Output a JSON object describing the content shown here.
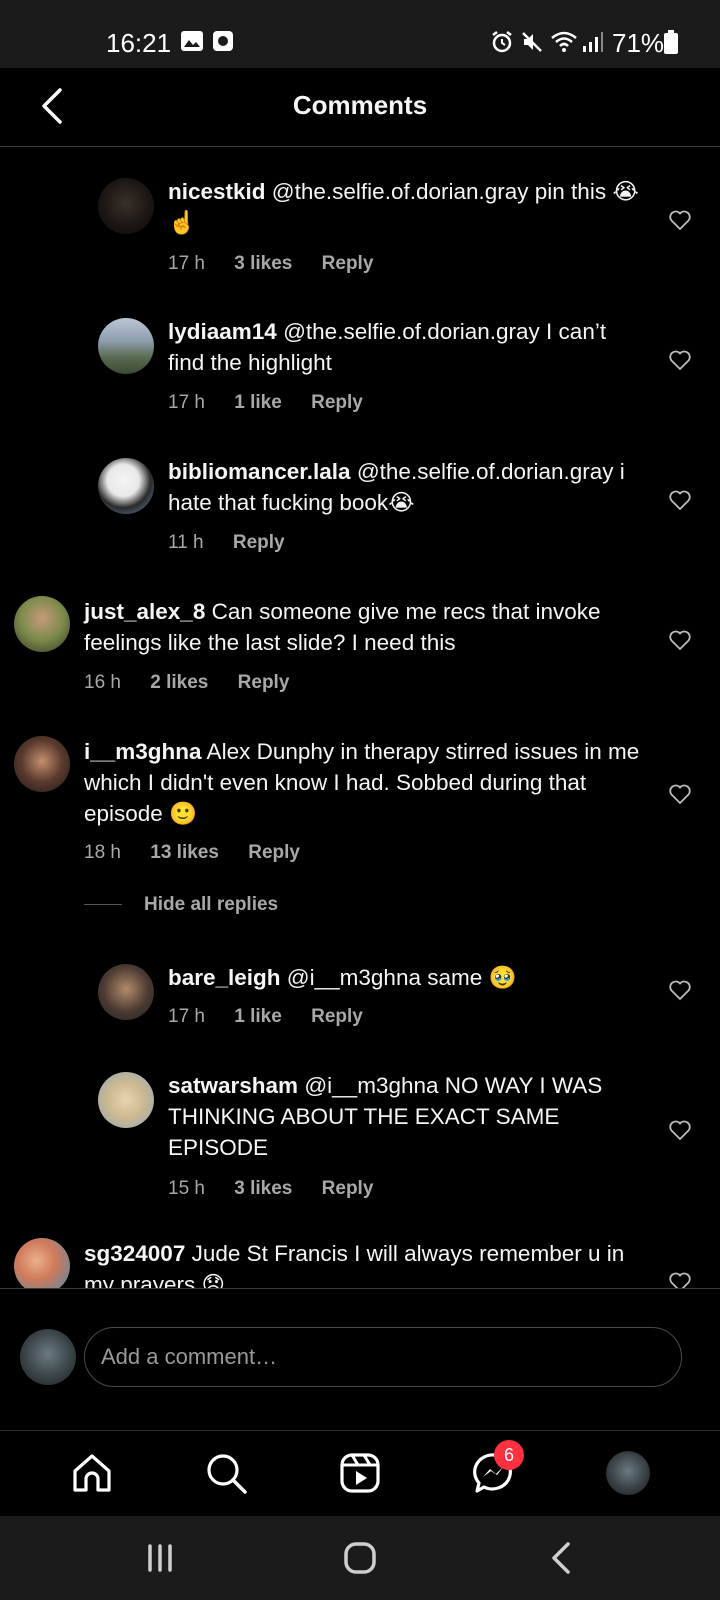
{
  "status_bar": {
    "time": "16:21",
    "battery": "71%",
    "icons": [
      "gallery-icon",
      "screenshot-icon",
      "alarm-icon",
      "mute-icon",
      "wifi-icon",
      "signal-icon",
      "battery-icon"
    ]
  },
  "header": {
    "title": "Comments"
  },
  "comments": [
    {
      "username": "nicestkid",
      "text": " @the.selfie.of.dorian.gray pin this 😭☝️",
      "time": "17 h",
      "likes": "3 likes",
      "reply": "Reply"
    },
    {
      "username": "lydiaam14",
      "text": " @the.selfie.of.dorian.gray I can’t find the highlight",
      "time": "17 h",
      "likes": "1 like",
      "reply": "Reply"
    },
    {
      "username": "bibliomancer.lala",
      "text": " @the.selfie.of.dorian.gray i hate that fucking book😭",
      "time": "11 h",
      "likes": "",
      "reply": "Reply"
    },
    {
      "username": "just_alex_8",
      "text": " Can someone give me recs that invoke feelings like the last slide? I need this",
      "time": "16 h",
      "likes": "2 likes",
      "reply": "Reply"
    },
    {
      "username": "i__m3ghna",
      "text": " Alex Dunphy in therapy stirred issues in me which I didn't even know I had. Sobbed during that episode 🙂",
      "time": "18 h",
      "likes": "13 likes",
      "reply": "Reply"
    },
    {
      "username": "bare_leigh",
      "text": " @i__m3ghna same 🥹",
      "time": "17 h",
      "likes": "1 like",
      "reply": "Reply"
    },
    {
      "username": "satwarsham",
      "text": " @i__m3ghna NO WAY I WAS THINKING ABOUT THE EXACT SAME EPISODE",
      "time": "15 h",
      "likes": "3 likes",
      "reply": "Reply"
    },
    {
      "username": "sg324007",
      "text": " Jude St Francis I will always remember u in my prayers 😞",
      "time": "",
      "likes": "",
      "reply": ""
    }
  ],
  "hide_replies": "Hide all replies",
  "add_comment": {
    "placeholder": "Add a comment…"
  },
  "bottom_nav": {
    "items": [
      "home-icon",
      "search-icon",
      "reels-icon",
      "messenger-icon",
      "profile-avatar"
    ],
    "messages_badge": "6"
  },
  "system_nav": [
    "recent-apps-button",
    "home-button",
    "back-button"
  ],
  "colors": {
    "background": "#000000",
    "secondary_text": "#a8a8a8",
    "badge": "#ff3040",
    "status_bar": "#1b1b1b"
  }
}
